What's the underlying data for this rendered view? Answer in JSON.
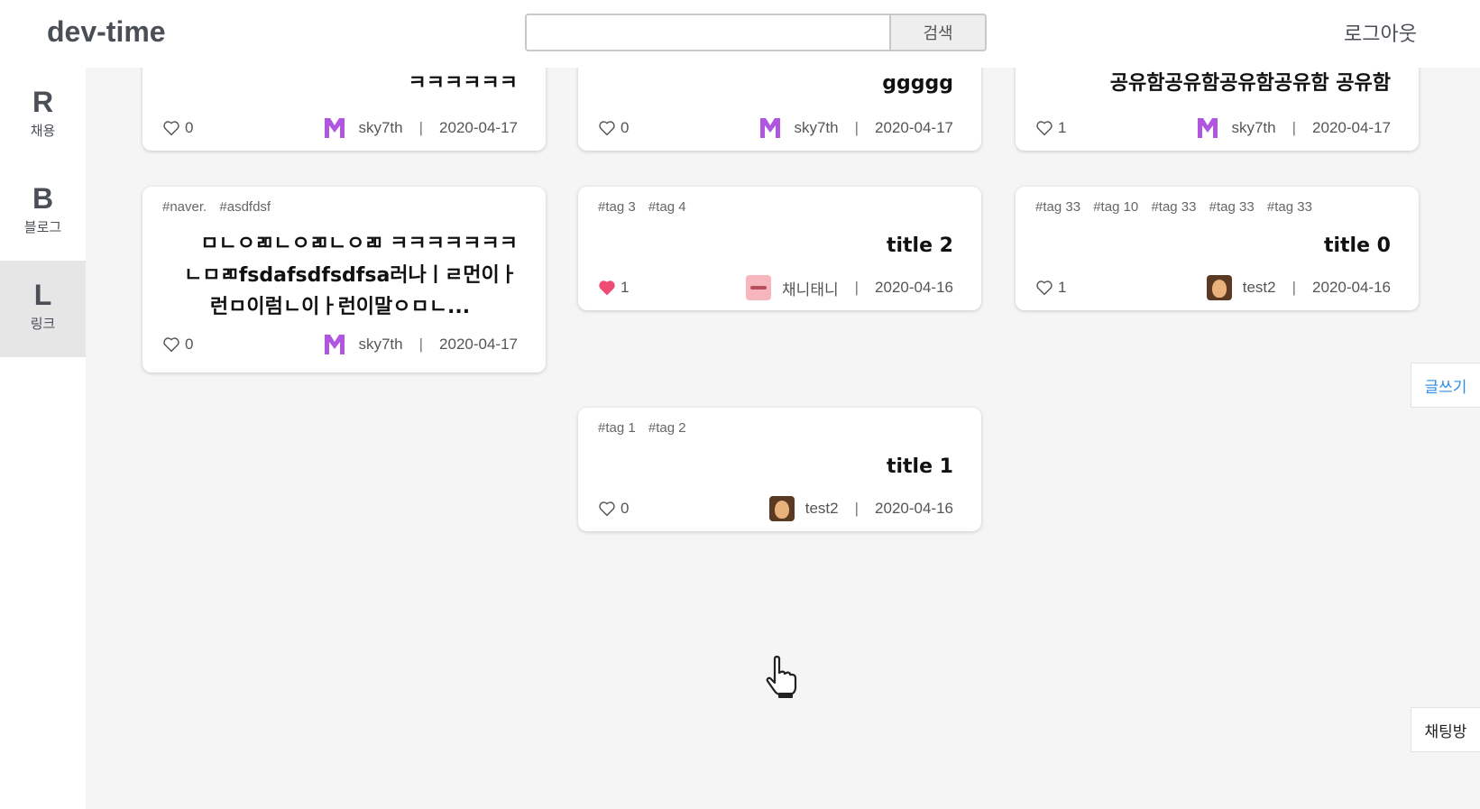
{
  "header": {
    "logo": "dev-time",
    "search_placeholder": "",
    "search_button": "검색",
    "logout": "로그아웃"
  },
  "sidebar": {
    "items": [
      {
        "letter": "R",
        "label": "채용"
      },
      {
        "letter": "B",
        "label": "블로그"
      },
      {
        "letter": "L",
        "label": "링크"
      }
    ]
  },
  "cards": [
    {
      "tags": [],
      "title": "ㅋㅋㅋㅋㅋㅋ",
      "likes": "0",
      "liked": false,
      "author": "sky7th",
      "separator": "|",
      "date": "2020-04-17"
    },
    {
      "tags": [],
      "title": "ggggg",
      "likes": "0",
      "liked": false,
      "author": "sky7th",
      "separator": "|",
      "date": "2020-04-17"
    },
    {
      "tags": [],
      "title": "공유함공유함공유함공유함 공유함",
      "likes": "1",
      "liked": false,
      "author": "sky7th",
      "separator": "|",
      "date": "2020-04-17"
    },
    {
      "tags": [
        "#naver.",
        "#asdfdsf"
      ],
      "title_lines": [
        "ㅁㄴㅇㄻㄴㅇㄻㄴㅇㄻ ㅋㅋㅋㅋㅋㅋㅋ",
        "ㄴㅁㄻfsdafsdfsdfsa러나ㅣㄹ먼이ㅏ",
        "런ㅁ이럼ㄴ이ㅏ런이말ㅇㅁㄴ..."
      ],
      "likes": "0",
      "liked": false,
      "author": "sky7th",
      "separator": "|",
      "date": "2020-04-17"
    },
    {
      "tags": [
        "#tag 3",
        "#tag 4"
      ],
      "title": "title 2",
      "likes": "1",
      "liked": true,
      "author": "채니태니",
      "separator": "|",
      "date": "2020-04-16"
    },
    {
      "tags": [
        "#tag 33",
        "#tag 10",
        "#tag 33",
        "#tag 33",
        "#tag 33"
      ],
      "title": "title 0",
      "likes": "1",
      "liked": false,
      "author": "test2",
      "separator": "|",
      "date": "2020-04-16"
    },
    {
      "tags": [
        "#tag 1",
        "#tag 2"
      ],
      "title": "title 1",
      "likes": "0",
      "liked": false,
      "author": "test2",
      "separator": "|",
      "date": "2020-04-16"
    }
  ],
  "floating": {
    "write": "글쓰기",
    "chat": "채팅방"
  },
  "colors": {
    "accent_blue": "#2f8de4",
    "like_red": "#ef4b73",
    "background": "#f5f5f5"
  }
}
